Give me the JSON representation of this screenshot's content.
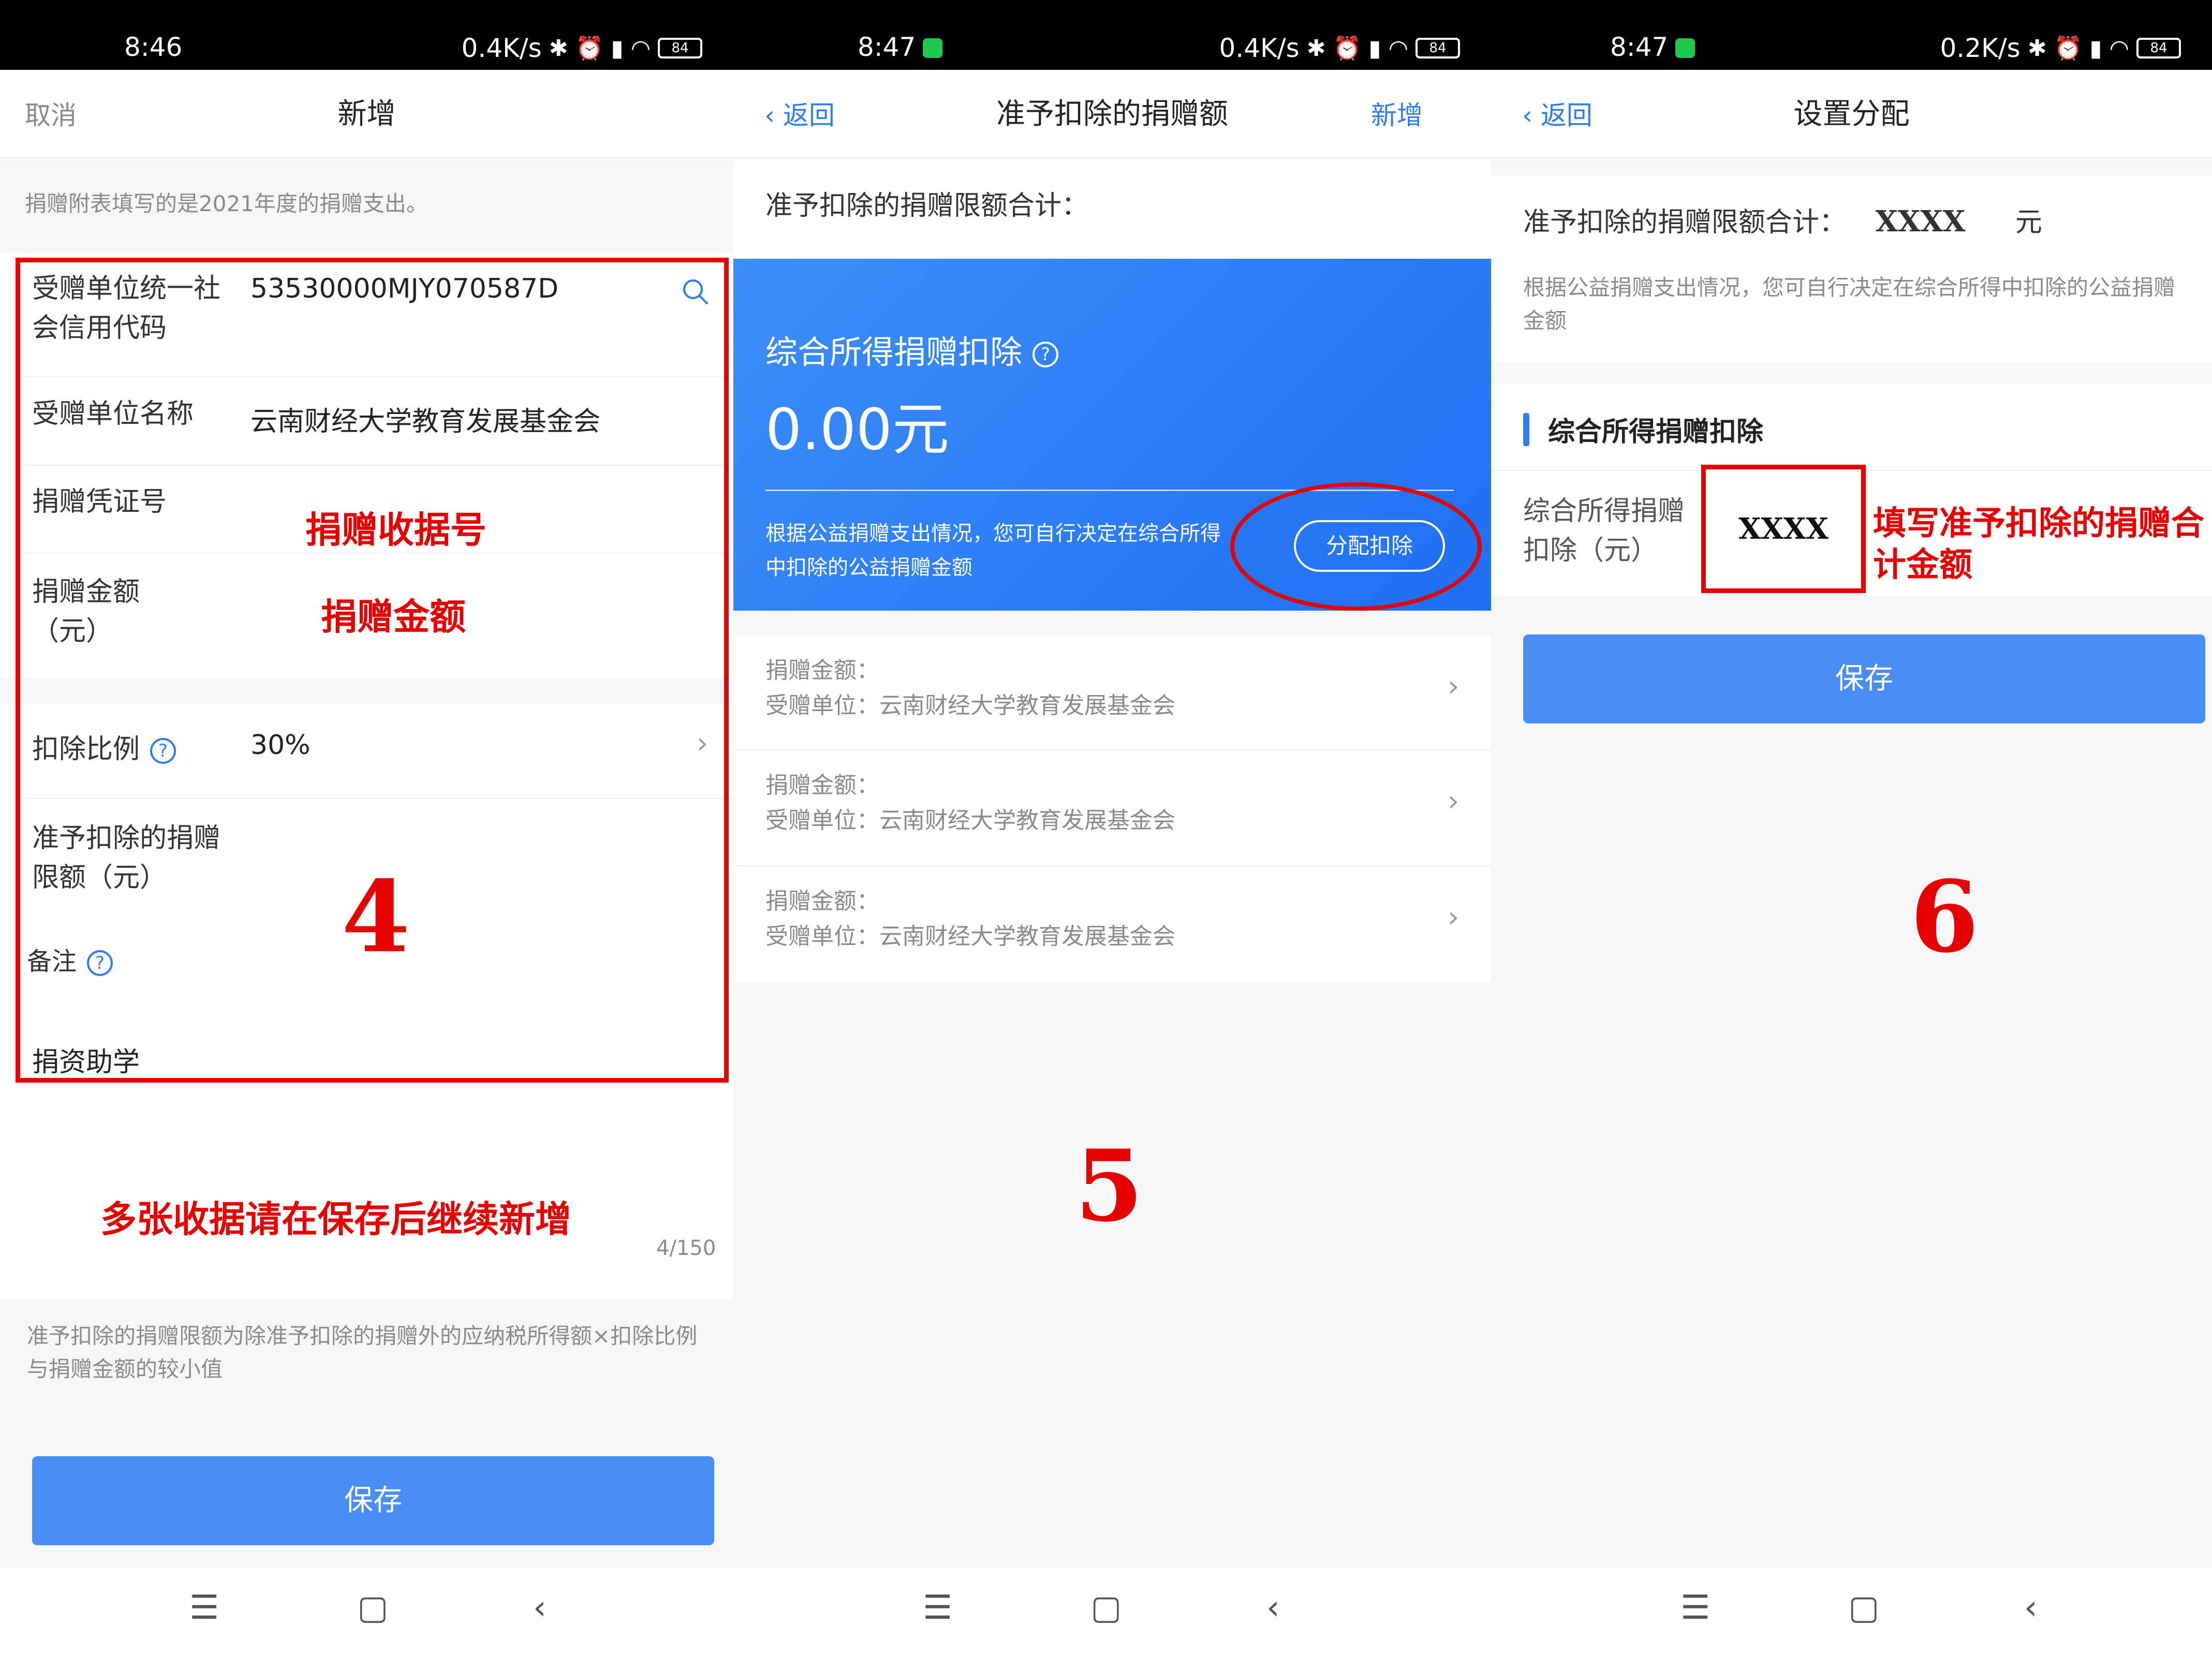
{
  "panel1": {
    "status": {
      "time": "8:46",
      "speed": "0.4K/s",
      "battery": "84"
    },
    "nav": {
      "cancel": "取消",
      "title": "新增"
    },
    "notice": "捐赠附表填写的是2021年度的捐赠支出。",
    "fields": {
      "credit_code_label": "受赠单位统一社会信用代码",
      "credit_code_value": "53530000MJY070587D",
      "org_name_label": "受赠单位名称",
      "org_name_value": "云南财经大学教育发展基金会",
      "voucher_label": "捐赠凭证号",
      "amount_label": "捐赠金额（元）",
      "ratio_label": "扣除比例",
      "ratio_value": "30%",
      "limit_label": "准予扣除的捐赠限额（元）",
      "remark_label": "备注",
      "remark_value": "捐资助学",
      "counter": "4/150"
    },
    "annotations": {
      "voucher_hint": "捐赠收据号",
      "amount_hint": "捐赠金额",
      "step": "4",
      "multi_hint": "多张收据请在保存后继续新增"
    },
    "footnote": "准予扣除的捐赠限额为除准予扣除的捐赠外的应纳税所得额×扣除比例与捐赠金额的较小值",
    "save": "保存",
    "bottom_nav": {
      "menu": "☰",
      "home": "▢",
      "back": "‹"
    }
  },
  "panel2": {
    "status": {
      "time": "8:47",
      "speed": "0.4K/s",
      "battery": "84"
    },
    "nav": {
      "back": "返回",
      "title": "准予扣除的捐赠额",
      "add": "新增"
    },
    "limit_total_label": "准予扣除的捐赠限额合计：",
    "card": {
      "title": "综合所得捐赠扣除",
      "amount": "0.00元",
      "desc": "根据公益捐赠支出情况，您可自行决定在综合所得中扣除的公益捐赠金额",
      "button": "分配扣除"
    },
    "records": [
      {
        "amount_label": "捐赠金额：",
        "org_label": "受赠单位：云南财经大学教育发展基金会"
      },
      {
        "amount_label": "捐赠金额：",
        "org_label": "受赠单位：云南财经大学教育发展基金会"
      },
      {
        "amount_label": "捐赠金额：",
        "org_label": "受赠单位：云南财经大学教育发展基金会"
      }
    ],
    "annotations": {
      "step": "5"
    },
    "bottom_nav": {
      "menu": "☰",
      "home": "▢",
      "back": "‹"
    }
  },
  "panel3": {
    "status": {
      "time": "8:47",
      "speed": "0.2K/s",
      "battery": "84"
    },
    "nav": {
      "back": "返回",
      "title": "设置分配"
    },
    "limit_total_label": "准予扣除的捐赠限额合计：",
    "limit_total_value": "XXXX",
    "limit_total_unit": "元",
    "desc": "根据公益捐赠支出情况，您可自行决定在综合所得中扣除的公益捐赠金额",
    "section_title": "综合所得捐赠扣除",
    "field_label": "综合所得捐赠扣除（元）",
    "field_value": "XXXX",
    "annotations": {
      "fill_hint": "填写准予扣除的捐赠合计金额",
      "step": "6"
    },
    "save": "保存",
    "bottom_nav": {
      "menu": "☰",
      "home": "▢",
      "back": "‹"
    }
  },
  "colors": {
    "primary": "#2f7bf2",
    "button": "#4a8ef5",
    "annotation": "#e60000",
    "card_gradient_start": "#3d8ef8",
    "card_gradient_end": "#1f6ff3"
  }
}
